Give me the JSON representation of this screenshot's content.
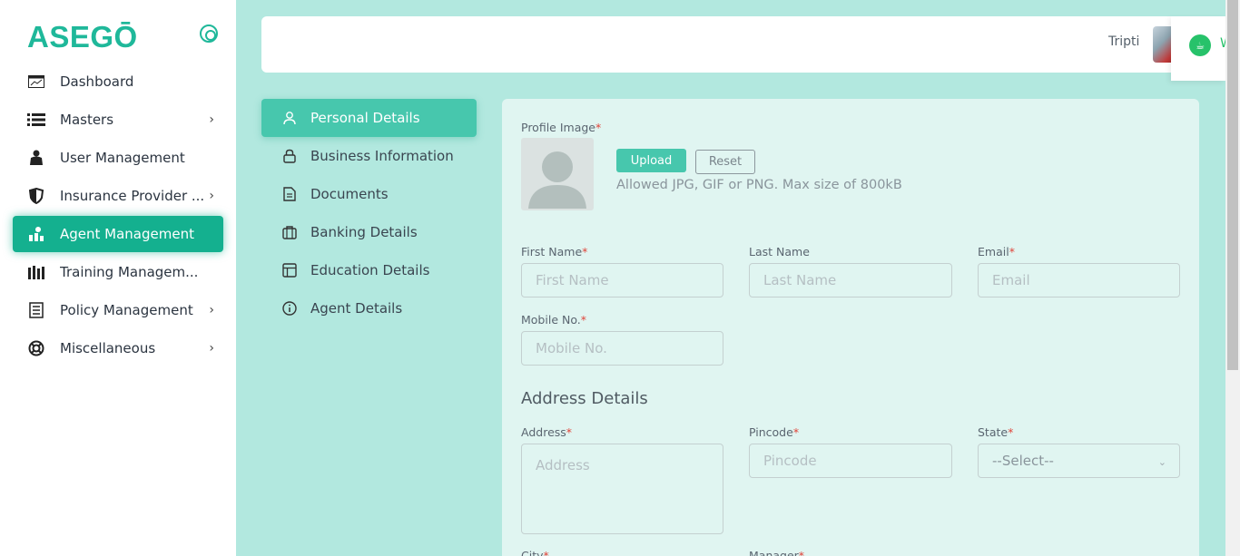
{
  "brand": {
    "logo_text": "ASEGŌ"
  },
  "sidebar": {
    "items": [
      {
        "label": "Dashboard",
        "icon": "dashboard-icon",
        "has_chevron": false
      },
      {
        "label": "Masters",
        "icon": "list-icon",
        "has_chevron": true
      },
      {
        "label": "User Management",
        "icon": "users-icon",
        "has_chevron": false
      },
      {
        "label": "Insurance Provider ...",
        "icon": "shield-icon",
        "has_chevron": true
      },
      {
        "label": "Agent Management",
        "icon": "agent-icon",
        "has_chevron": false,
        "active": true
      },
      {
        "label": "Training Managem...",
        "icon": "books-icon",
        "has_chevron": false
      },
      {
        "label": "Policy Management",
        "icon": "document-icon",
        "has_chevron": true
      },
      {
        "label": "Miscellaneous",
        "icon": "lifebuoy-icon",
        "has_chevron": true
      }
    ]
  },
  "header": {
    "user_name": "Tripti",
    "float_text": "W"
  },
  "tabs": [
    {
      "label": "Personal Details",
      "icon": "person-icon",
      "active": true
    },
    {
      "label": "Business Information",
      "icon": "lock-icon"
    },
    {
      "label": "Documents",
      "icon": "file-icon"
    },
    {
      "label": "Banking Details",
      "icon": "briefcase-icon"
    },
    {
      "label": "Education Details",
      "icon": "layout-icon"
    },
    {
      "label": "Agent Details",
      "icon": "info-icon"
    }
  ],
  "form": {
    "profile_image_label": "Profile Image",
    "upload_label": "Upload",
    "reset_label": "Reset",
    "upload_hint": "Allowed JPG, GIF or PNG. Max size of 800kB",
    "first_name": {
      "label": "First Name",
      "placeholder": "First Name",
      "required": true
    },
    "last_name": {
      "label": "Last Name",
      "placeholder": "Last Name",
      "required": false
    },
    "email": {
      "label": "Email",
      "placeholder": "Email",
      "required": true
    },
    "mobile": {
      "label": "Mobile No.",
      "placeholder": "Mobile No.",
      "required": true
    },
    "address_section_title": "Address Details",
    "address": {
      "label": "Address",
      "placeholder": "Address",
      "required": true
    },
    "pincode": {
      "label": "Pincode",
      "placeholder": "Pincode",
      "required": true
    },
    "state": {
      "label": "State",
      "value": "--Select--",
      "required": true
    },
    "city": {
      "label": "City",
      "required": true
    },
    "manager": {
      "label": "Manager",
      "required": true
    }
  },
  "colors": {
    "accent": "#14b08f",
    "tab_active": "#47c7ad",
    "background": "#b2e8df",
    "required": "#e0453a"
  }
}
